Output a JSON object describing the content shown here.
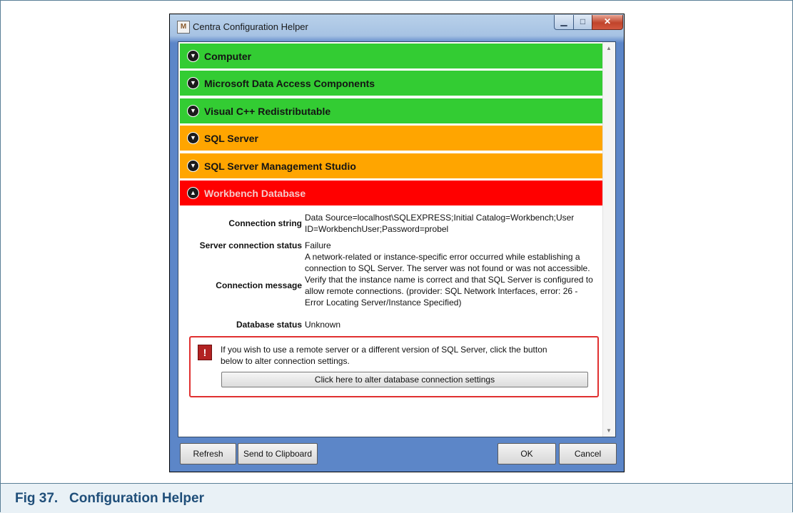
{
  "window": {
    "title": "Centra Configuration Helper",
    "icon": "app-icon",
    "icon_glyph": "M"
  },
  "sections": [
    {
      "label": "Computer",
      "status": "ok",
      "expanded": false
    },
    {
      "label": "Microsoft Data Access Components",
      "status": "ok",
      "expanded": false
    },
    {
      "label": "Visual C++ Redistributable",
      "status": "ok",
      "expanded": false
    },
    {
      "label": "SQL Server",
      "status": "warning",
      "expanded": false
    },
    {
      "label": "SQL Server Management Studio",
      "status": "warning",
      "expanded": false
    },
    {
      "label": "Workbench Database",
      "status": "error",
      "expanded": true
    }
  ],
  "details": {
    "connection_string_label": "Connection string",
    "connection_string_value_1": "Data Source=localhost\\SQLEXPRESS;Initial Catalog=Workbench;User",
    "connection_string_value_2": "ID=WorkbenchUser;Password=probel",
    "server_status_label": "Server connection status",
    "server_status_value": "Failure",
    "connection_message_label": "Connection message",
    "connection_message_lines": [
      "A network-related or instance-specific error occurred while establishing a",
      "connection to SQL Server. The server was not found or was not accessible.",
      "Verify that the instance name is correct and that SQL Server is configured to",
      "allow remote connections. (provider: SQL Network Interfaces, error: 26 -",
      "Error Locating Server/Instance Specified)"
    ],
    "database_status_label": "Database status",
    "database_status_value": "Unknown"
  },
  "alert": {
    "text_1": "If you wish to use a remote server or a different version of SQL Server, click the button",
    "text_2": "below to alter connection settings.",
    "button_label": "Click here to alter database connection settings"
  },
  "buttons": {
    "refresh": "Refresh",
    "clipboard": "Send to Clipboard",
    "ok": "OK",
    "cancel": "Cancel"
  },
  "caption": "Fig 37.   Configuration Helper",
  "colors": {
    "ok": "#33cc33",
    "warning": "#ffa500",
    "error": "#ff0000",
    "caption_text": "#1f4e79"
  }
}
